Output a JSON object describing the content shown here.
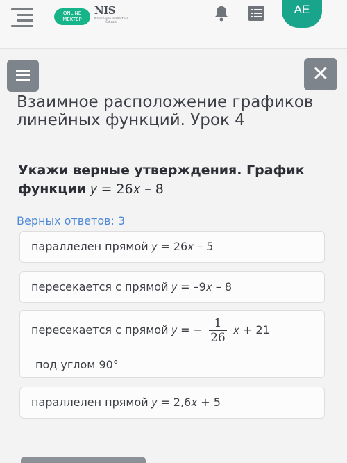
{
  "header": {
    "logo_online_line1": "ONLINE",
    "logo_online_line2": "MEKTEP",
    "logo_nis": "NIS",
    "logo_nis_sub": "Nazarbayev Intellectual Schools",
    "avatar_initials": "AE",
    "icons": [
      "menu-icon",
      "bell-icon",
      "list-icon"
    ]
  },
  "lesson": {
    "title": "Взаимное расположение графиков линейных функций. Урок 4"
  },
  "question": {
    "text": "Укажи верные утверждения. График функции",
    "formula": "𝑦 = 26𝑥 – 8"
  },
  "answers_count": "Верных ответов: 3",
  "options": [
    {
      "label": "параллелен прямой 𝑦 = 26𝑥 – 5"
    },
    {
      "label": "пересекается с прямой 𝑦 = –9𝑥 – 8"
    },
    {
      "label_prefix": "пересекается с прямой 𝑦 = −",
      "frac_num": "1",
      "frac_den": "26",
      "label_suffix": "𝑥 + 21",
      "label_line2": "под углом 90°"
    },
    {
      "label": "параллелен прямой 𝑦 = 2,6𝑥 + 5"
    }
  ],
  "colors": {
    "accent": "#17b489",
    "avatar": "#19a58b",
    "link": "#4f8ad6",
    "button": "#7e848c"
  }
}
